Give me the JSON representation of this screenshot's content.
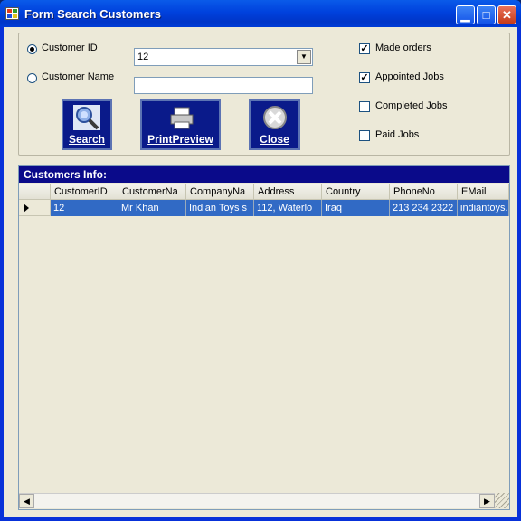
{
  "window": {
    "title": "Form Search Customers",
    "minimize_glyph": "▁",
    "maximize_glyph": "□",
    "close_glyph": "✕"
  },
  "search": {
    "customer_id_label": "Customer ID",
    "customer_name_label": "Customer Name",
    "customer_id_value": "12",
    "customer_name_value": "",
    "selected_option": "Customer ID"
  },
  "filters": [
    {
      "label": "Made  orders",
      "checked": true
    },
    {
      "label": "Appointed Jobs",
      "checked": true
    },
    {
      "label": "Completed Jobs",
      "checked": false
    },
    {
      "label": "Paid Jobs",
      "checked": false
    }
  ],
  "buttons": {
    "search": "Search",
    "print_preview": "PrintPreview",
    "close": "Close"
  },
  "grid": {
    "caption": "Customers Info:",
    "columns": [
      "CustomerID",
      "CustomerNa",
      "CompanyNa",
      "Address",
      "Country",
      "PhoneNo",
      "EMail"
    ],
    "rows": [
      [
        "12",
        "Mr Khan",
        "Indian Toys s",
        "112, Waterlo",
        "Iraq",
        "213 234 2322",
        "indiantoys.s"
      ]
    ],
    "scroll_left_glyph": "◀",
    "scroll_right_glyph": "▶"
  },
  "colors": {
    "titlebar": "#0041dd",
    "button_bg": "#0a1a8a",
    "selection": "#316ac5",
    "caption_bg": "#0a0a8a"
  },
  "icons": {
    "search": "magnifier-icon",
    "print": "printer-icon",
    "close": "close-x-icon"
  }
}
